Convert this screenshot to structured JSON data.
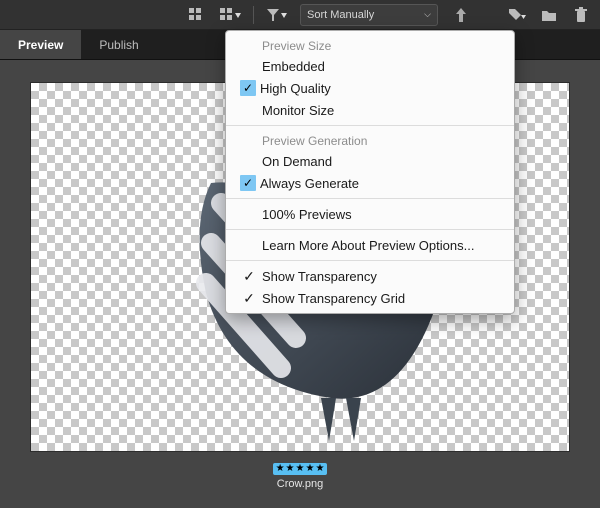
{
  "toolbar": {
    "sort_label": "Sort Manually"
  },
  "tabs": {
    "preview": "Preview",
    "publish": "Publish"
  },
  "thumb": {
    "filename": "Crow.png",
    "rating": 5
  },
  "menu": {
    "ps_header": "Preview Size",
    "ps_embedded": "Embedded",
    "ps_hq": "High Quality",
    "ps_monitor": "Monitor Size",
    "pg_header": "Preview Generation",
    "pg_on_demand": "On Demand",
    "pg_always": "Always Generate",
    "pct_previews": "100% Previews",
    "learn_more": "Learn More About Preview Options...",
    "show_trans": "Show Transparency",
    "show_trans_grid": "Show Transparency Grid"
  }
}
